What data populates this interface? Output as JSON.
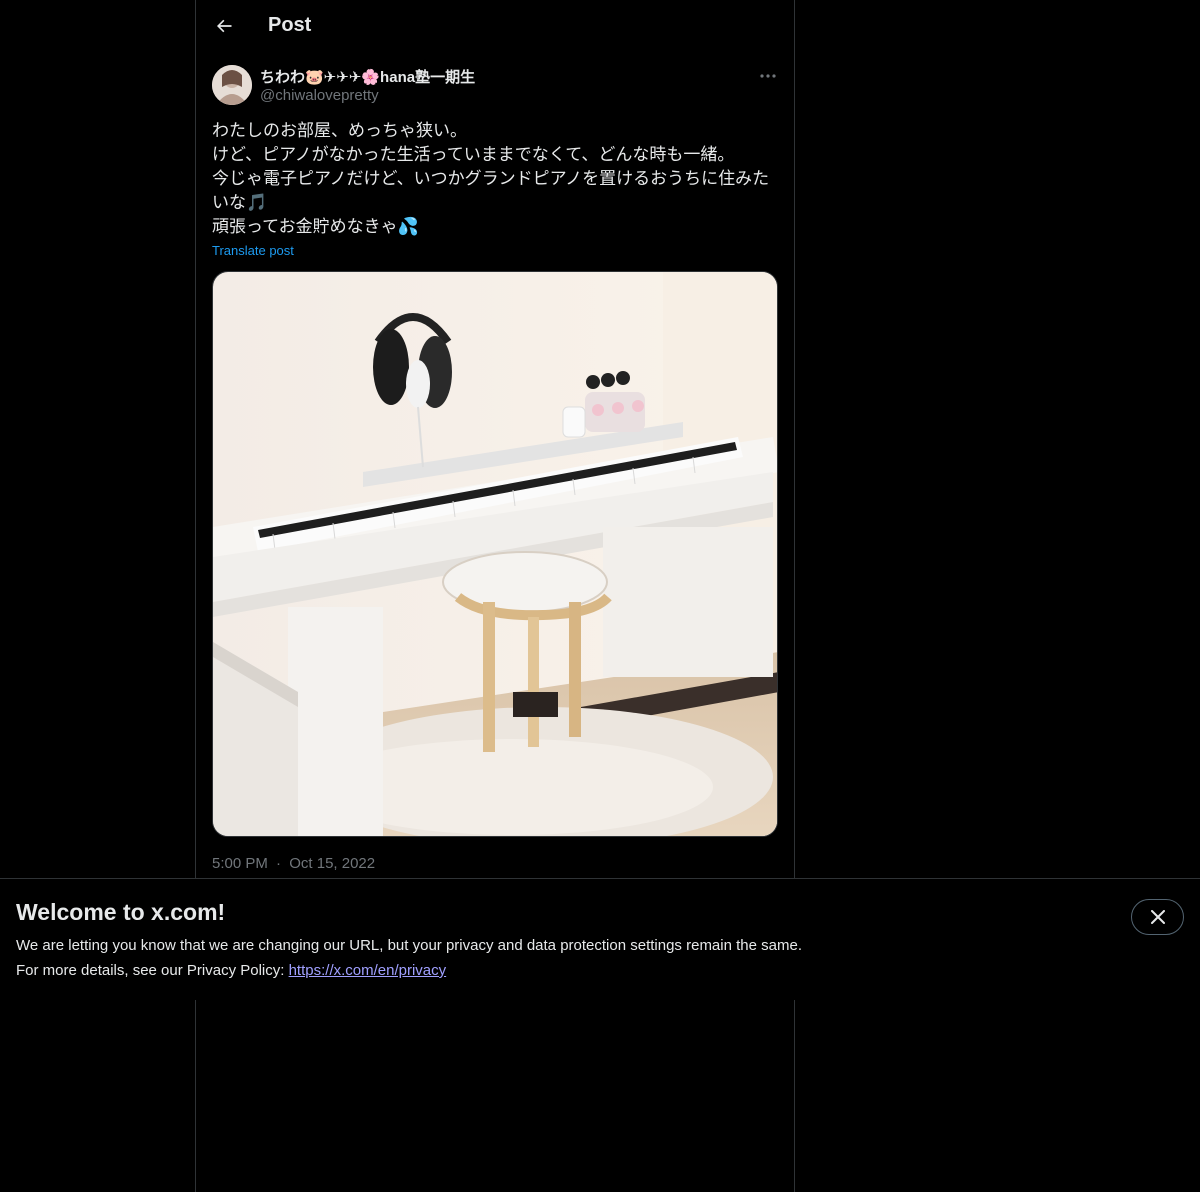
{
  "header": {
    "title": "Post",
    "back_icon": "arrow-left-icon"
  },
  "post": {
    "author": {
      "display_name": "ちわわ🐷✈✈✈🌸hana塾一期生",
      "handle": "@chiwalovepretty"
    },
    "more_icon": "more-horizontal-icon",
    "text_lines": [
      "わたしのお部屋、めっちゃ狭い。",
      "けど、ピアノがなかった生活っていままでなくて、どんな時も一緒。",
      "今じゃ電子ピアノだけど、いつかグランドピアノを置けるおうちに住みた",
      "いな🎵",
      "頑張ってお金貯めなきゃ💦"
    ],
    "translate_label": "Translate post",
    "time": "5:00 PM",
    "separator": "·",
    "date": "Oct 15, 2022"
  },
  "banner": {
    "title": "Welcome to x.com!",
    "line1": "We are letting you know that we are changing our URL, but your privacy and data protection settings remain the same.",
    "line2_prefix": "For more details, see our Privacy Policy: ",
    "link": "https://x.com/en/privacy",
    "close_icon": "close-icon"
  },
  "colors": {
    "background": "#000000",
    "text": "#e7e9ea",
    "secondary": "#71767b",
    "link": "#1d9bf0",
    "border": "#2f3336"
  }
}
